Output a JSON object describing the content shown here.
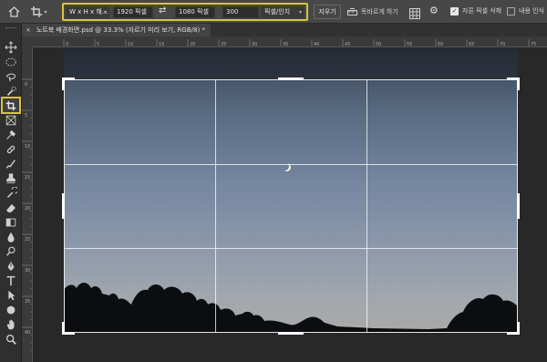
{
  "options_bar": {
    "ratio_preset": "W x H x 해...",
    "width_value": "1920 픽셀",
    "height_value": "1080 픽셀",
    "resolution_value": "300",
    "resolution_unit": "픽셀/인치",
    "clear_label": "지우기",
    "straighten_label": "똑바르게 하기",
    "delete_cropped_label": "자른 픽셀 삭제",
    "delete_cropped_checked": true,
    "content_aware_label": "내용 인식",
    "content_aware_checked": false,
    "highlight_color": "#d8c53a"
  },
  "document": {
    "tab_title": "노트북 배경화면.psd @ 33.3% (자르기 미리 보기, RGB/8) *",
    "close_symbol": "×"
  },
  "rulers": {
    "top_labels": [
      "0",
      "5",
      "10",
      "15",
      "20",
      "25",
      "30",
      "35",
      "40",
      "45",
      "50",
      "55",
      "60",
      "65",
      "70",
      "75"
    ],
    "left_labels": [
      "0",
      "5",
      "10",
      "15",
      "20",
      "25",
      "30",
      "35",
      "40"
    ]
  },
  "toolbox": {
    "tools": [
      "move-tool-icon",
      "marquee-tool-icon",
      "lasso-tool-icon",
      "quick-selection-tool-icon",
      "crop-tool-icon",
      "frame-tool-icon",
      "eyedropper-tool-icon",
      "healing-brush-tool-icon",
      "brush-tool-icon",
      "clone-stamp-tool-icon",
      "history-brush-tool-icon",
      "eraser-tool-icon",
      "gradient-tool-icon",
      "blur-tool-icon",
      "dodge-tool-icon",
      "pen-tool-icon",
      "type-tool-icon",
      "path-selection-tool-icon",
      "shape-tool-icon",
      "hand-tool-icon",
      "zoom-tool-icon"
    ],
    "active_tool": "crop-tool-icon"
  },
  "canvas": {
    "sky_top_color": "#384154",
    "sky_bottom_color": "#aaa9a6",
    "tree_color": "#0b0d10",
    "grid_color": "#ffffff"
  }
}
